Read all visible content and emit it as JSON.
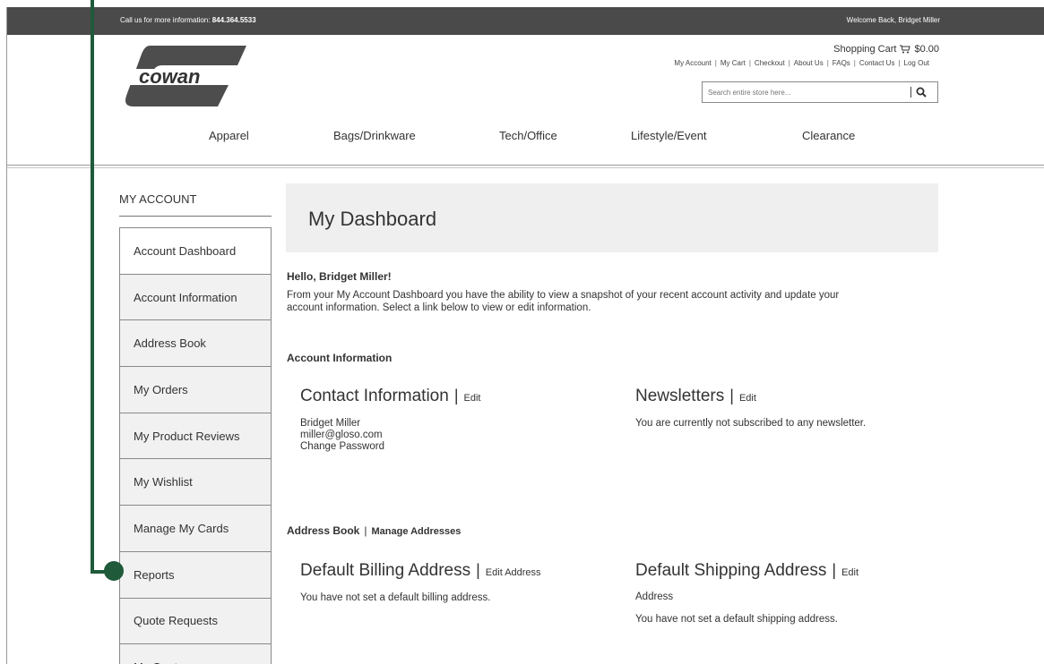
{
  "topbar": {
    "call_prefix": "Call us for more information: ",
    "phone": "844.364.5533",
    "welcome": "Welcome Back, Bridget Miller"
  },
  "header": {
    "logo_text": "cowan",
    "cart_label": "Shopping Cart",
    "cart_total": "$0.00",
    "links": [
      "My Account",
      "My Cart",
      "Checkout",
      "About Us",
      "FAQs",
      "Contact Us",
      "Log Out"
    ],
    "search_placeholder": "Search entire store here..."
  },
  "nav": [
    "Apparel",
    "Bags/Drinkware",
    "Tech/Office",
    "Lifestyle/Event",
    "Clearance"
  ],
  "sidebar": {
    "title": "MY ACCOUNT",
    "items": [
      "Account Dashboard",
      "Account Information",
      "Address Book",
      "My Orders",
      "My Product Reviews",
      "My Wishlist",
      "Manage My Cards",
      "Reports",
      "Quote Requests",
      "My Quotes"
    ]
  },
  "main": {
    "title": "My Dashboard",
    "hello": "Hello, Bridget Miller!",
    "intro": "From your My Account Dashboard you have the ability to view a snapshot of your recent account activity and update your account information. Select a link below to view or edit information.",
    "account_info_heading": "Account Information",
    "contact": {
      "heading": "Contact Information",
      "edit": "Edit",
      "name": "Bridget Miller",
      "email": "miller@gloso.com",
      "change_password": "Change Password"
    },
    "newsletters": {
      "heading": "Newsletters",
      "edit": "Edit",
      "text": "You are currently not subscribed to any newsletter."
    },
    "address_book": {
      "heading": "Address Book",
      "manage": "Manage Addresses"
    },
    "billing": {
      "heading": "Default Billing Address",
      "edit": "Edit Address",
      "text": "You have not set a default billing address."
    },
    "shipping": {
      "heading": "Default Shipping Address",
      "edit": "Edit",
      "edit_wrap": "Address",
      "text": "You have not set a default shipping address."
    }
  },
  "colors": {
    "topbar": "#4a4a4a",
    "annotation": "#1f5a3a",
    "sidebar_item": "#f1f1f1",
    "dashboard_box": "#efefef"
  }
}
